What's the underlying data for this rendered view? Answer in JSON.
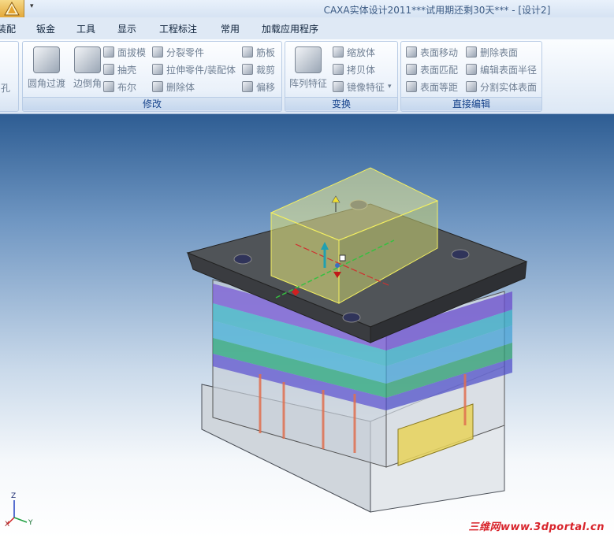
{
  "titlebar": {
    "title": "CAXA实体设计2011***试用期还剩30天*** - [设计2]"
  },
  "tabs": [
    "装配",
    "钣金",
    "工具",
    "显示",
    "工程标注",
    "常用",
    "加载应用程序"
  ],
  "ribbon": {
    "partial_left_label": "孔",
    "groups": [
      {
        "label": "修改",
        "large_buttons": [
          "圆角过渡",
          "边倒角"
        ],
        "small_buttons": [
          "面拔模",
          "抽壳",
          "布尔",
          "分裂零件",
          "拉伸零件/装配体",
          "删除体",
          "筋板",
          "裁剪",
          "偏移"
        ]
      },
      {
        "label": "变换",
        "large_buttons": [
          "阵列特征"
        ],
        "small_buttons": [
          "缩放体",
          "拷贝体",
          "镜像特征"
        ]
      },
      {
        "label": "直接编辑",
        "small_buttons": [
          "表面移动",
          "删除表面",
          "表面匹配",
          "编辑表面半径",
          "表面等距",
          "分割实体表面"
        ]
      }
    ]
  },
  "viewport": {
    "axis_labels": {
      "z": "Z",
      "x": "X",
      "y": "Y"
    },
    "watermark": "三维网www.3dportal.cn"
  },
  "colors": {
    "title_text": "#3c5b84",
    "ribbon_label": "#15428b",
    "viewport_top": "#2e5d93",
    "watermark": "#d8232a"
  }
}
